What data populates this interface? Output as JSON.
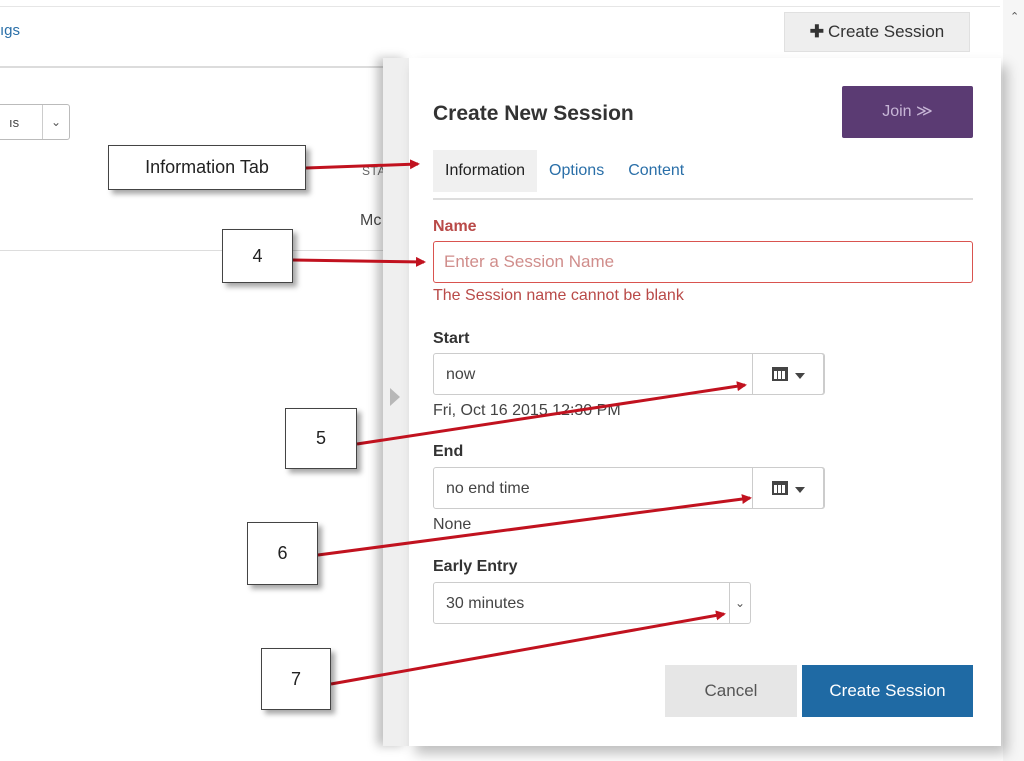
{
  "background": {
    "link_text": "ıgs",
    "select_text": "ıs",
    "column_header": "STA",
    "row_text": "Mc",
    "create_session_label": "Create Session",
    "create_session_icon": "plus-icon"
  },
  "panel": {
    "title": "Create New Session",
    "join_label": "Join ≫",
    "tabs": [
      {
        "label": "Information",
        "active": true
      },
      {
        "label": "Options",
        "active": false
      },
      {
        "label": "Content",
        "active": false
      }
    ],
    "name": {
      "label": "Name",
      "placeholder": "Enter a Session Name",
      "value": "",
      "error": "The Session name cannot be blank"
    },
    "start": {
      "label": "Start",
      "value": "now",
      "resolved": "Fri, Oct 16 2015 12:30 PM",
      "button_icon": "calendar-icon"
    },
    "end": {
      "label": "End",
      "value": "no end time",
      "resolved": "None",
      "button_icon": "calendar-icon"
    },
    "early_entry": {
      "label": "Early Entry",
      "value": "30 minutes"
    },
    "cancel_label": "Cancel",
    "create_label": "Create Session"
  },
  "callouts": {
    "info_tab": "Information Tab",
    "c4": "4",
    "c5": "5",
    "c6": "6",
    "c7": "7"
  },
  "colors": {
    "accent_blue": "#1f6aa4",
    "join_purple": "#5b3b73",
    "error_red": "#b94a48",
    "arrow_red": "#c1121f"
  }
}
